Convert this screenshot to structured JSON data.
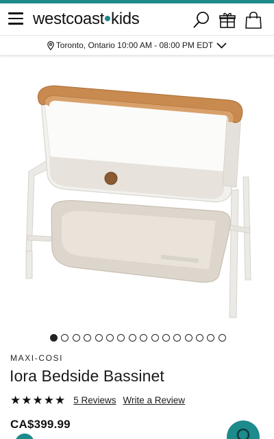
{
  "header": {
    "logo_left": "westcoast",
    "logo_right": "kids",
    "accent_color": "#1d8a8c",
    "icons": [
      "menu-icon",
      "search-icon",
      "gift-icon",
      "shopping-bag-icon"
    ]
  },
  "location": {
    "text": "Toronto, Ontario 10:00 AM - 08:00 PM EDT"
  },
  "gallery": {
    "image_count": 16,
    "active_index": 0
  },
  "product": {
    "brand": "MAXI-COSI",
    "title": "Iora Bedside Bassinet",
    "rating_stars": 5,
    "reviews_label": "5 Reviews",
    "write_review_label": "Write a Review",
    "price": "CA$399.99"
  }
}
